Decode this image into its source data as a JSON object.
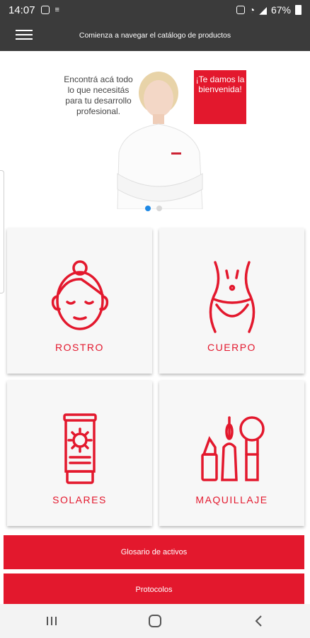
{
  "status_bar": {
    "time": "14:07",
    "battery": "67%"
  },
  "app_bar": {
    "title": "Comienza a navegar el catálogo de productos",
    "menu_icon": "hamburger-menu-icon"
  },
  "banner": {
    "text": "Encontrá acá todo lo que necesitás para tu desarrollo profesional.",
    "badge": "¡Te damos la bienvenida!",
    "slides_total": 2,
    "slide_active": 1
  },
  "categories": [
    {
      "label": "ROSTRO",
      "icon": "face-icon"
    },
    {
      "label": "CUERPO",
      "icon": "body-icon"
    },
    {
      "label": "SOLARES",
      "icon": "sunscreen-icon"
    },
    {
      "label": "MAQUILLAJE",
      "icon": "makeup-icon"
    }
  ],
  "buttons": {
    "glossary": "Glosario de activos",
    "protocols": "Protocolos"
  },
  "colors": {
    "accent": "#e3182d",
    "bar": "#3b3b3b",
    "dot_active": "#1e88e5"
  }
}
